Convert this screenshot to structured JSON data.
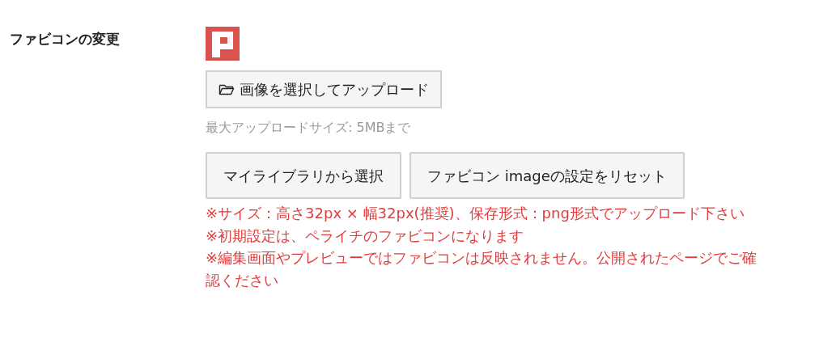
{
  "setting_label": "ファビコンの変更",
  "upload_button": "画像を選択してアップロード",
  "max_size_hint": "最大アップロードサイズ: 5MBまで",
  "buttons": [
    "マイライブラリから選択",
    "ファビコン imageの設定をリセット"
  ],
  "notes": [
    "※サイズ：高さ32px × 幅32px(推奨)、保存形式：png形式でアップロード下さい",
    "※初期設定は、ペライチのファビコンになります",
    "※編集画面やプレビューではファビコンは反映されません。公開されたページでご確認ください"
  ]
}
